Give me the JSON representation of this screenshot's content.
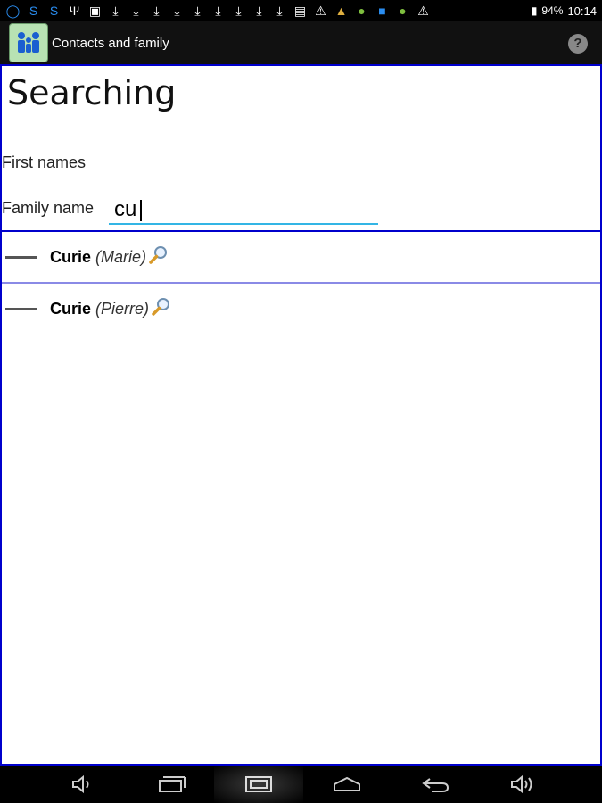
{
  "status_bar": {
    "icons": [
      "sync-icon",
      "sync-icon",
      "sync-icon",
      "usb-icon",
      "image-icon",
      "download-icon",
      "download-icon",
      "download-icon",
      "download-icon",
      "download-icon",
      "download-icon",
      "download-icon",
      "download-icon",
      "download-icon",
      "gallery-icon",
      "warning-icon",
      "cleaner-icon",
      "android-icon",
      "photo-icon",
      "android-icon",
      "warning-icon"
    ],
    "battery": "94%",
    "time": "10:14"
  },
  "action_bar": {
    "title": "Contacts and family",
    "help_label": "?"
  },
  "search": {
    "heading": "Searching",
    "first_names_label": "First names",
    "first_names_value": "",
    "family_name_label": "Family name",
    "family_name_value": "cu"
  },
  "results": [
    {
      "surname": "Curie",
      "given": "(Marie)"
    },
    {
      "surname": "Curie",
      "given": "(Pierre)"
    }
  ],
  "nav_bar": {
    "buttons": [
      "volume-down-icon",
      "recent-apps-icon",
      "screenshot-icon",
      "home-icon",
      "back-icon",
      "volume-up-icon"
    ]
  }
}
